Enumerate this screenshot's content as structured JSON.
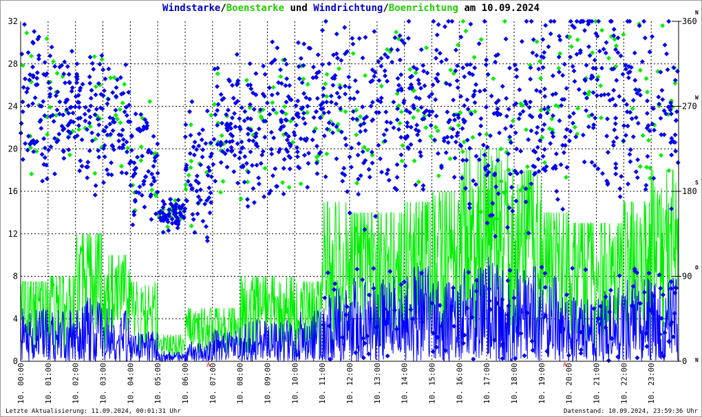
{
  "title": {
    "part1": "Windstarke",
    "sep1": "/",
    "part2": "Boenstarke",
    "mid": " und ",
    "part3": "Windrichtung",
    "sep2": "/",
    "part4": "Boenrichtung",
    "tail": " am 10.09.2024"
  },
  "footer": {
    "left": "Letzte Aktualisierung: 11.09.2024, 00:01:31 Uhr",
    "right": "Datenstand: 10.09.2024, 23:59:36 Uhr"
  },
  "colors": {
    "wind": "#0000ff",
    "gust": "#00ee00",
    "grid": "#000000",
    "marker": "#ff0000"
  },
  "chart_data": {
    "type": "scatter",
    "title": "Windstarke/Boenstarke und Windrichtung/Boenrichtung am 10.09.2024",
    "y_left": {
      "range": [
        0,
        32
      ],
      "ticks": [
        "0",
        "4",
        "8",
        "12",
        "16",
        "20",
        "24",
        "28",
        "32"
      ]
    },
    "y_right": {
      "range": [
        0,
        360
      ],
      "ticks": [
        "0",
        "90",
        "180",
        "270",
        "360"
      ],
      "compass": [
        "N",
        "O",
        "S",
        "W",
        "N"
      ]
    },
    "x_ticks": [
      "10. 00:00",
      "10. 01:00",
      "10. 02:00",
      "10. 03:00",
      "10. 04:00",
      "10. 05:00",
      "10. 06:00",
      "10. 07:00",
      "10. 08:00",
      "10. 09:00",
      "10. 10:00",
      "10. 11:00",
      "10. 12:00",
      "10. 13:00",
      "10. 14:00",
      "10. 15:00",
      "10. 16:00",
      "10. 17:00",
      "10. 18:00",
      "10. 19:00",
      "10. 20:00",
      "10. 21:00",
      "10. 22:00",
      "10. 23:00"
    ],
    "markers": [
      {
        "hour": 6.85,
        "label": "A"
      },
      {
        "hour": 19.85,
        "label": "A"
      }
    ],
    "hourly_wind_max": [
      5,
      5,
      6,
      5,
      3,
      1,
      2,
      3,
      4,
      4,
      5,
      7,
      8,
      8,
      9,
      8,
      9,
      10,
      9,
      8,
      6,
      7,
      8,
      8
    ],
    "hourly_gust_max": [
      7.5,
      8,
      12,
      10,
      7.5,
      2.5,
      5,
      5,
      8,
      8,
      7.5,
      15,
      14,
      14,
      15,
      16,
      20,
      20,
      18,
      14,
      13,
      13,
      15,
      18
    ],
    "hourly_direction_center": [
      270,
      265,
      260,
      255,
      200,
      155,
      200,
      250,
      240,
      250,
      260,
      270,
      250,
      270,
      270,
      280,
      260,
      240,
      260,
      270,
      300,
      280,
      280,
      270
    ],
    "hourly_direction_spread": [
      90,
      60,
      70,
      70,
      60,
      15,
      60,
      60,
      70,
      70,
      70,
      80,
      90,
      80,
      80,
      80,
      100,
      100,
      100,
      100,
      90,
      90,
      90,
      90
    ]
  }
}
